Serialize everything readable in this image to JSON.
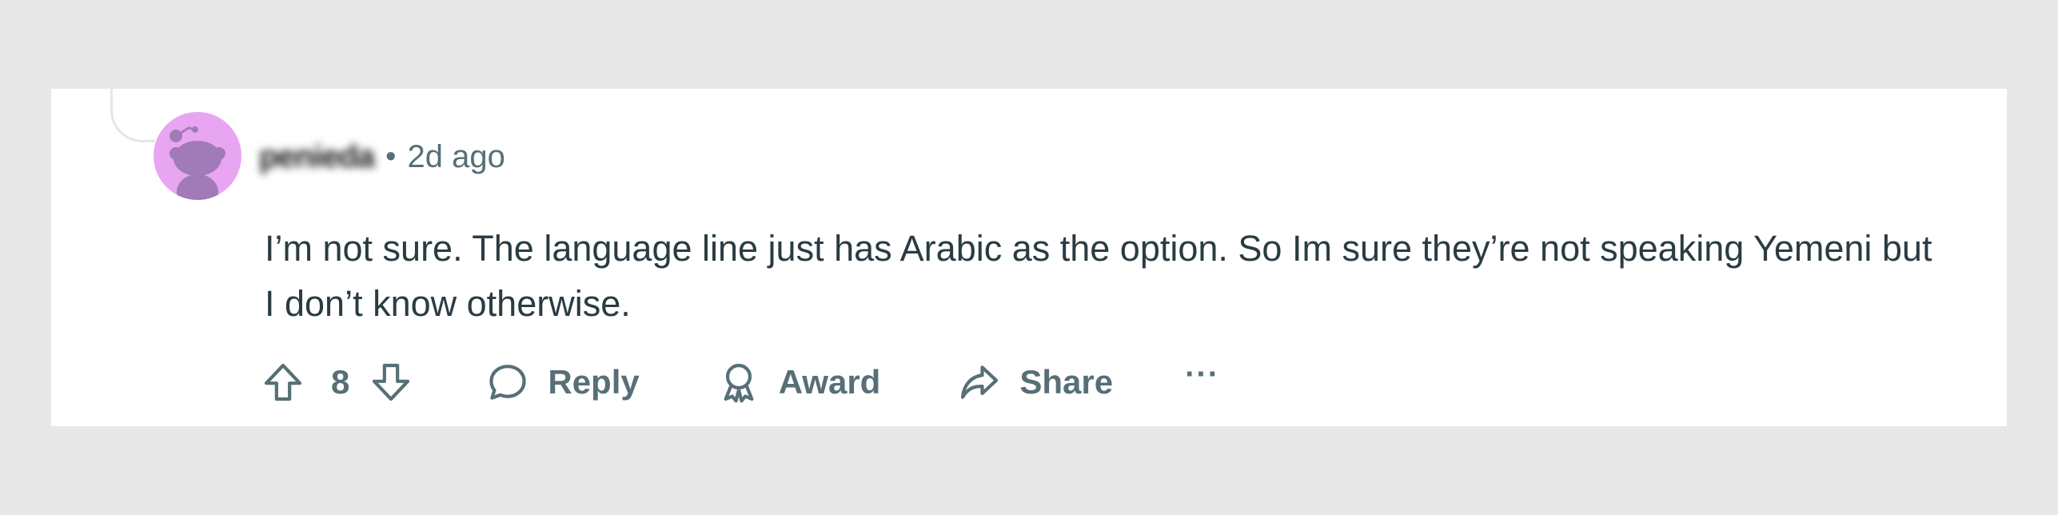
{
  "comment": {
    "username": "penieda",
    "separator": "•",
    "timestamp": "2d ago",
    "body": "I’m not sure. The language line just has Arabic as the option. So Im sure they’re not speaking Yemeni but I don’t know otherwise."
  },
  "actions": {
    "vote_count": "8",
    "reply_label": "Reply",
    "award_label": "Award",
    "share_label": "Share",
    "more_label": "···"
  },
  "icons": {
    "upvote": "arrow-up-outline-icon",
    "downvote": "arrow-down-outline-icon",
    "reply": "speech-bubble-icon",
    "award": "award-ribbon-icon",
    "share": "share-arrow-icon",
    "avatar": "snoo-avatar-icon"
  },
  "colors": {
    "page_bg": "#e8e8e8",
    "card_bg": "#ffffff",
    "avatar_bg": "#e8a6f2",
    "text": "#2a3c42",
    "muted": "#576f76"
  }
}
